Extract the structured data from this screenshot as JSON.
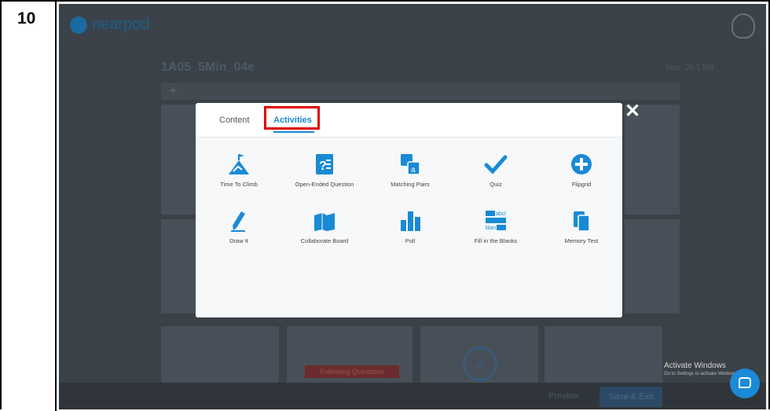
{
  "row_number": "10",
  "app": {
    "name": "nearpod"
  },
  "background": {
    "lesson_title": "1A05_5Min_04e",
    "lesson_subtitle": "Preview",
    "size_label": "Size: 20.1 MB",
    "add_slide_label": "Add Slide",
    "following_questions_label": "Following Questions",
    "previous_label": "Preview",
    "save_exit_label": "Save & Exit"
  },
  "modal": {
    "tabs": [
      {
        "label": "Content",
        "active": false
      },
      {
        "label": "Activities",
        "active": true
      }
    ],
    "close_label": "✕",
    "accent_color": "#1a8ad5",
    "highlight_color": "#e00000",
    "activities": [
      {
        "label": "Time To Climb",
        "icon": "mountain-flag-icon"
      },
      {
        "label": "Open-Ended Question",
        "icon": "question-doc-icon"
      },
      {
        "label": "Matching Pairs",
        "icon": "matching-cards-icon"
      },
      {
        "label": "Quiz",
        "icon": "checkmark-icon"
      },
      {
        "label": "Flipgrid",
        "icon": "plus-circle-icon"
      },
      {
        "label": "Draw It",
        "icon": "pencil-icon"
      },
      {
        "label": "Collaborate Board",
        "icon": "board-icon"
      },
      {
        "label": "Poll",
        "icon": "bar-chart-icon"
      },
      {
        "label": "Fill in the Blanks",
        "icon": "fill-blanks-icon"
      },
      {
        "label": "Memory Test",
        "icon": "memory-cards-icon"
      }
    ]
  },
  "os_overlay": {
    "activate_title": "Activate Windows",
    "activate_sub": "Go to Settings to activate Windows."
  }
}
